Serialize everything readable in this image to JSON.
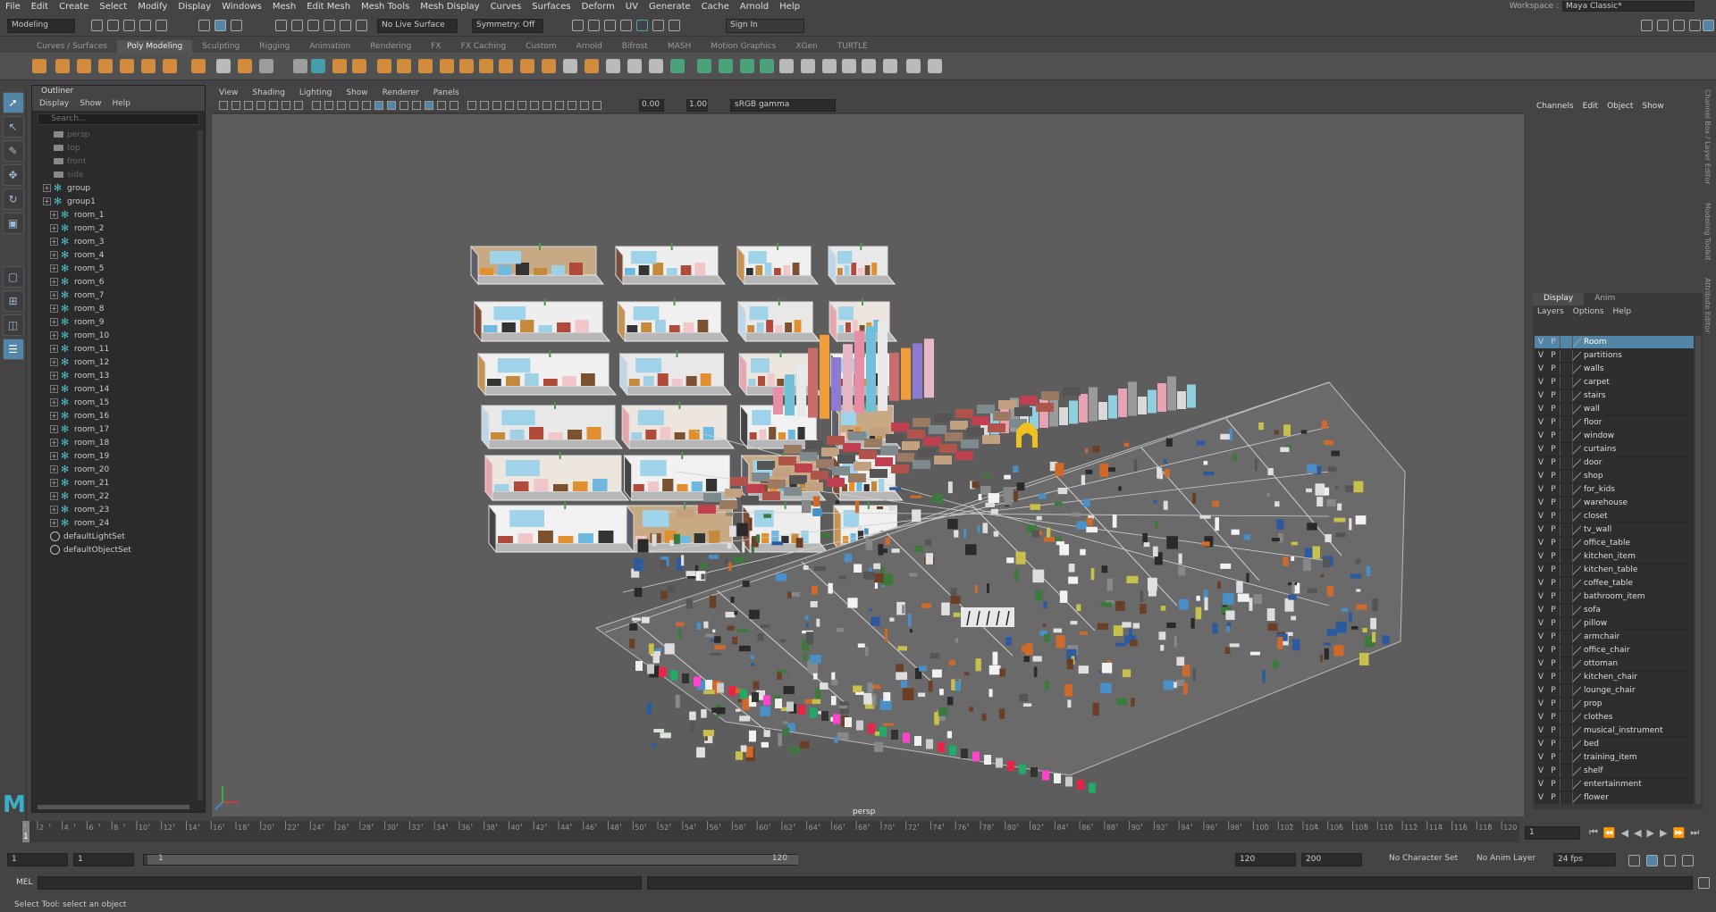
{
  "menubar": [
    "File",
    "Edit",
    "Create",
    "Select",
    "Modify",
    "Display",
    "Windows",
    "Mesh",
    "Edit Mesh",
    "Mesh Tools",
    "Mesh Display",
    "Curves",
    "Surfaces",
    "Deform",
    "UV",
    "Generate",
    "Cache",
    "Arnold",
    "Help"
  ],
  "workspace": {
    "label": "Workspace :",
    "value": "Maya Classic*"
  },
  "statusline": {
    "mode": "Modeling",
    "live_surface": "No Live Surface",
    "symmetry": "Symmetry: Off",
    "sign_in": "Sign In"
  },
  "shelf_tabs": [
    "Curves / Surfaces",
    "Poly Modeling",
    "Sculpting",
    "Rigging",
    "Animation",
    "Rendering",
    "FX",
    "FX Caching",
    "Custom",
    "Arnold",
    "Bifrost",
    "MASH",
    "Motion Graphics",
    "XGen",
    "TURTLE"
  ],
  "shelf_active_tab": "Poly Modeling",
  "outliner": {
    "title": "Outliner",
    "menu": [
      "Display",
      "Show",
      "Help"
    ],
    "search_placeholder": "Search...",
    "cameras": [
      "persp",
      "top",
      "front",
      "side"
    ],
    "groups": [
      "group",
      "group1"
    ],
    "rooms": [
      "room_1",
      "room_2",
      "room_3",
      "room_4",
      "room_5",
      "room_6",
      "room_7",
      "room_8",
      "room_9",
      "room_10",
      "room_11",
      "room_12",
      "room_13",
      "room_14",
      "room_15",
      "room_16",
      "room_17",
      "room_18",
      "room_19",
      "room_20",
      "room_21",
      "room_22",
      "room_23",
      "room_24"
    ],
    "sets": [
      "defaultLightSet",
      "defaultObjectSet"
    ]
  },
  "viewport": {
    "menu": [
      "View",
      "Shading",
      "Lighting",
      "Show",
      "Renderer",
      "Panels"
    ],
    "exposure": "0.00",
    "gamma": "1.00",
    "color_space": "sRGB gamma",
    "camera": "persp"
  },
  "channel_box": {
    "menu": [
      "Channels",
      "Edit",
      "Object",
      "Show"
    ]
  },
  "side_tabs": [
    "Channel Box / Layer Editor",
    "Modeling Toolkit",
    "Attribute Editor"
  ],
  "layer_editor": {
    "tabs": [
      "Display",
      "Anim"
    ],
    "menu": [
      "Layers",
      "Options",
      "Help"
    ],
    "v": "V",
    "p": "P",
    "layers": [
      "Room",
      "partitions",
      "walls",
      "carpet",
      "stairs",
      "wall",
      "floor",
      "window",
      "curtains",
      "door",
      "shop",
      "for_kids",
      "warehouse",
      "closet",
      "tv_wall",
      "office_table",
      "kitchen_item",
      "kitchen_table",
      "coffee_table",
      "bathroom_item",
      "sofa",
      "pillow",
      "armchair",
      "office_chair",
      "ottoman",
      "kitchen_chair",
      "lounge_chair",
      "prop",
      "clothes",
      "musical_instrument",
      "bed",
      "training_item",
      "shelf",
      "entertainment",
      "flower"
    ]
  },
  "timeline": {
    "ticks": [
      "2",
      "4",
      "6",
      "8",
      "10",
      "12",
      "14",
      "16",
      "18",
      "20",
      "22",
      "24",
      "26",
      "28",
      "30",
      "32",
      "34",
      "36",
      "38",
      "40",
      "42",
      "44",
      "46",
      "48",
      "50",
      "52",
      "54",
      "56",
      "58",
      "60",
      "62",
      "64",
      "66",
      "68",
      "70",
      "72",
      "74",
      "76",
      "78",
      "80",
      "82",
      "84",
      "86",
      "88",
      "90",
      "92",
      "94",
      "96",
      "98",
      "100",
      "102",
      "104",
      "106",
      "108",
      "110",
      "112",
      "114",
      "116",
      "118",
      "120"
    ],
    "current_frame": "1",
    "current_field": "1"
  },
  "range": {
    "start": "1",
    "start2": "1",
    "range_start": "1",
    "range_end": "120",
    "end": "120",
    "end2": "200",
    "character_set": "No Character Set",
    "anim_layer": "No Anim Layer",
    "fps": "24 fps"
  },
  "cmdline": {
    "label": "MEL"
  },
  "helpline": "Select Tool: select an object",
  "colors": {
    "accent": "#5285a6",
    "viewport": "#5d5d5d",
    "panel": "#444444",
    "orange_icon": "#e8953a"
  }
}
